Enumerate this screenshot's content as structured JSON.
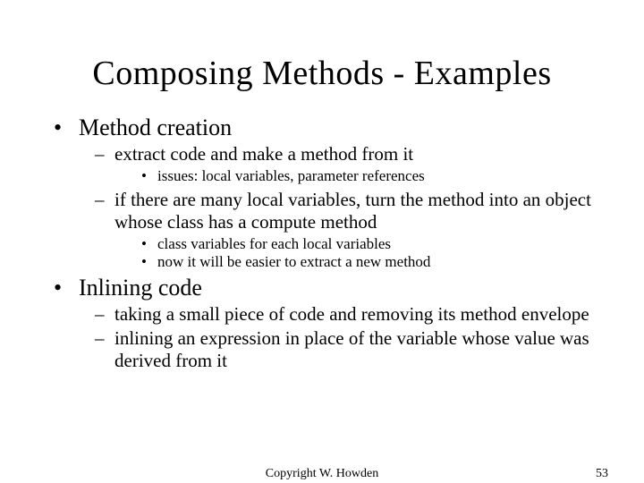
{
  "title": "Composing Methods - Examples",
  "bullets": [
    {
      "text": "Method creation",
      "children": [
        {
          "text": "extract code and make a method from it",
          "children": [
            {
              "text": "issues: local variables, parameter references"
            }
          ]
        },
        {
          "text": "if there are many local variables, turn the method into an object whose class has a compute method",
          "children": [
            {
              "text": "class variables for each local variables"
            },
            {
              "text": "now it will be easier to extract a new method"
            }
          ]
        }
      ]
    },
    {
      "text": "Inlining code",
      "children": [
        {
          "text": "taking a small piece of code and removing its method envelope"
        },
        {
          "text": "inlining an expression in place of the variable whose value was derived from it"
        }
      ]
    }
  ],
  "footer": {
    "copyright": "Copyright W. Howden",
    "page": "53"
  },
  "glyphs": {
    "l1": "•",
    "l2": "–",
    "l3": "•"
  }
}
